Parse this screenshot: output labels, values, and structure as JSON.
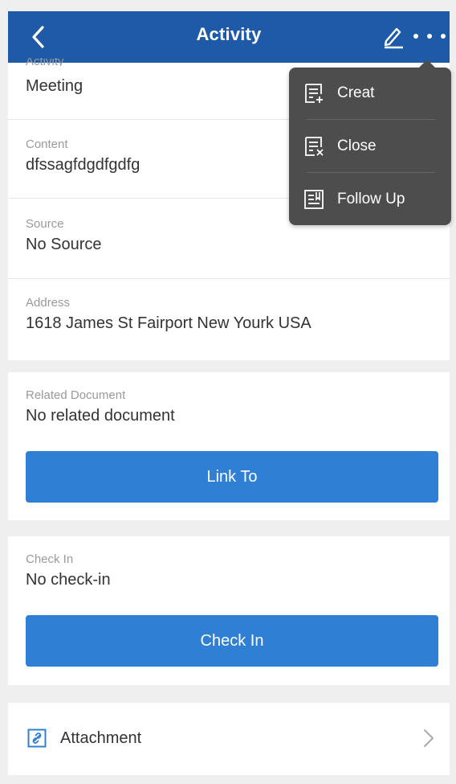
{
  "header": {
    "title": "Activity"
  },
  "fields": {
    "activity": {
      "label": "Activity",
      "value": "Meeting"
    },
    "content": {
      "label": "Content",
      "value": "dfssagfdgdfgdfg"
    },
    "source": {
      "label": "Source",
      "value": "No Source"
    },
    "address": {
      "label": "Address",
      "value": "1618 James St Fairport New Yourk USA"
    },
    "related": {
      "label": "Related Document",
      "value": "No related document"
    },
    "checkin": {
      "label": "Check In",
      "value": "No check-in"
    }
  },
  "buttons": {
    "link_to": "Link To",
    "check_in": "Check In"
  },
  "attachment": {
    "label": "Attachment"
  },
  "menu": {
    "items": [
      {
        "label": "Creat",
        "icon": "create-doc-icon"
      },
      {
        "label": "Close",
        "icon": "close-doc-icon"
      },
      {
        "label": "Follow Up",
        "icon": "follow-up-icon"
      }
    ]
  },
  "colors": {
    "header": "#1e5aa8",
    "button": "#2f80d4",
    "popup": "#4d4d4d"
  }
}
